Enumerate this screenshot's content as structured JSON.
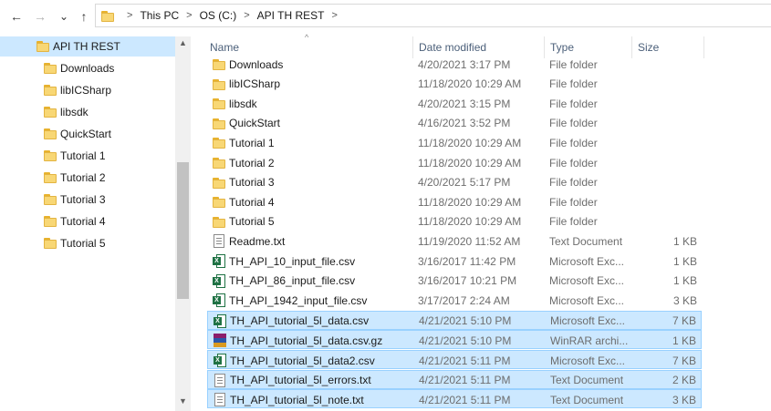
{
  "address": {
    "crumbs": [
      "This PC",
      "OS (C:)",
      "API TH REST"
    ],
    "separator": ">"
  },
  "nav_buttons": {
    "back": "←",
    "forward": "→",
    "recent": "⌄",
    "up": "↑"
  },
  "navpane": {
    "items": [
      {
        "label": "API TH REST",
        "selected": true
      },
      {
        "label": "Downloads"
      },
      {
        "label": "libICSharp"
      },
      {
        "label": "libsdk"
      },
      {
        "label": "QuickStart"
      },
      {
        "label": "Tutorial 1"
      },
      {
        "label": "Tutorial 2"
      },
      {
        "label": "Tutorial 3"
      },
      {
        "label": "Tutorial 4"
      },
      {
        "label": "Tutorial 5"
      }
    ],
    "scroll_up": "▲",
    "scroll_down": "▼"
  },
  "columns": {
    "name": "Name",
    "date": "Date modified",
    "type": "Type",
    "size": "Size",
    "sort_caret": "^"
  },
  "files": [
    {
      "name": "Downloads",
      "date": "4/20/2021 3:17 PM",
      "type": "File folder",
      "size": "",
      "icon": "folder-icon"
    },
    {
      "name": "libICSharp",
      "date": "11/18/2020 10:29 AM",
      "type": "File folder",
      "size": "",
      "icon": "folder-icon"
    },
    {
      "name": "libsdk",
      "date": "4/20/2021 3:15 PM",
      "type": "File folder",
      "size": "",
      "icon": "folder-icon"
    },
    {
      "name": "QuickStart",
      "date": "4/16/2021 3:52 PM",
      "type": "File folder",
      "size": "",
      "icon": "folder-icon"
    },
    {
      "name": "Tutorial 1",
      "date": "11/18/2020 10:29 AM",
      "type": "File folder",
      "size": "",
      "icon": "folder-icon"
    },
    {
      "name": "Tutorial 2",
      "date": "11/18/2020 10:29 AM",
      "type": "File folder",
      "size": "",
      "icon": "folder-icon"
    },
    {
      "name": "Tutorial 3",
      "date": "4/20/2021 5:17 PM",
      "type": "File folder",
      "size": "",
      "icon": "folder-icon"
    },
    {
      "name": "Tutorial 4",
      "date": "11/18/2020 10:29 AM",
      "type": "File folder",
      "size": "",
      "icon": "folder-icon"
    },
    {
      "name": "Tutorial 5",
      "date": "11/18/2020 10:29 AM",
      "type": "File folder",
      "size": "",
      "icon": "folder-icon"
    },
    {
      "name": "Readme.txt",
      "date": "11/19/2020 11:52 AM",
      "type": "Text Document",
      "size": "1 KB",
      "icon": "text-document-icon"
    },
    {
      "name": "TH_API_10_input_file.csv",
      "date": "3/16/2017 11:42 PM",
      "type": "Microsoft Exc...",
      "size": "1 KB",
      "icon": "excel-csv-icon"
    },
    {
      "name": "TH_API_86_input_file.csv",
      "date": "3/16/2017 10:21 PM",
      "type": "Microsoft Exc...",
      "size": "1 KB",
      "icon": "excel-csv-icon"
    },
    {
      "name": "TH_API_1942_input_file.csv",
      "date": "3/17/2017 2:24 AM",
      "type": "Microsoft Exc...",
      "size": "3 KB",
      "icon": "excel-csv-icon"
    },
    {
      "name": "TH_API_tutorial_5l_data.csv",
      "date": "4/21/2021 5:10 PM",
      "type": "Microsoft Exc...",
      "size": "7 KB",
      "icon": "excel-csv-icon",
      "selected": true
    },
    {
      "name": "TH_API_tutorial_5l_data.csv.gz",
      "date": "4/21/2021 5:10 PM",
      "type": "WinRAR archi...",
      "size": "1 KB",
      "icon": "winrar-archive-icon",
      "selected": true
    },
    {
      "name": "TH_API_tutorial_5l_data2.csv",
      "date": "4/21/2021 5:11 PM",
      "type": "Microsoft Exc...",
      "size": "7 KB",
      "icon": "excel-csv-icon",
      "selected": true
    },
    {
      "name": "TH_API_tutorial_5l_errors.txt",
      "date": "4/21/2021 5:11 PM",
      "type": "Text Document",
      "size": "2 KB",
      "icon": "text-document-icon",
      "selected": true
    },
    {
      "name": "TH_API_tutorial_5l_note.txt",
      "date": "4/21/2021 5:11 PM",
      "type": "Text Document",
      "size": "3 KB",
      "icon": "text-document-icon",
      "selected": true
    }
  ],
  "colors": {
    "selection_bg": "#cce8ff",
    "selection_border": "#99d1ff",
    "folder_yellow": "#f8d775",
    "excel_green": "#1f7244",
    "header_text": "#4c607a"
  }
}
